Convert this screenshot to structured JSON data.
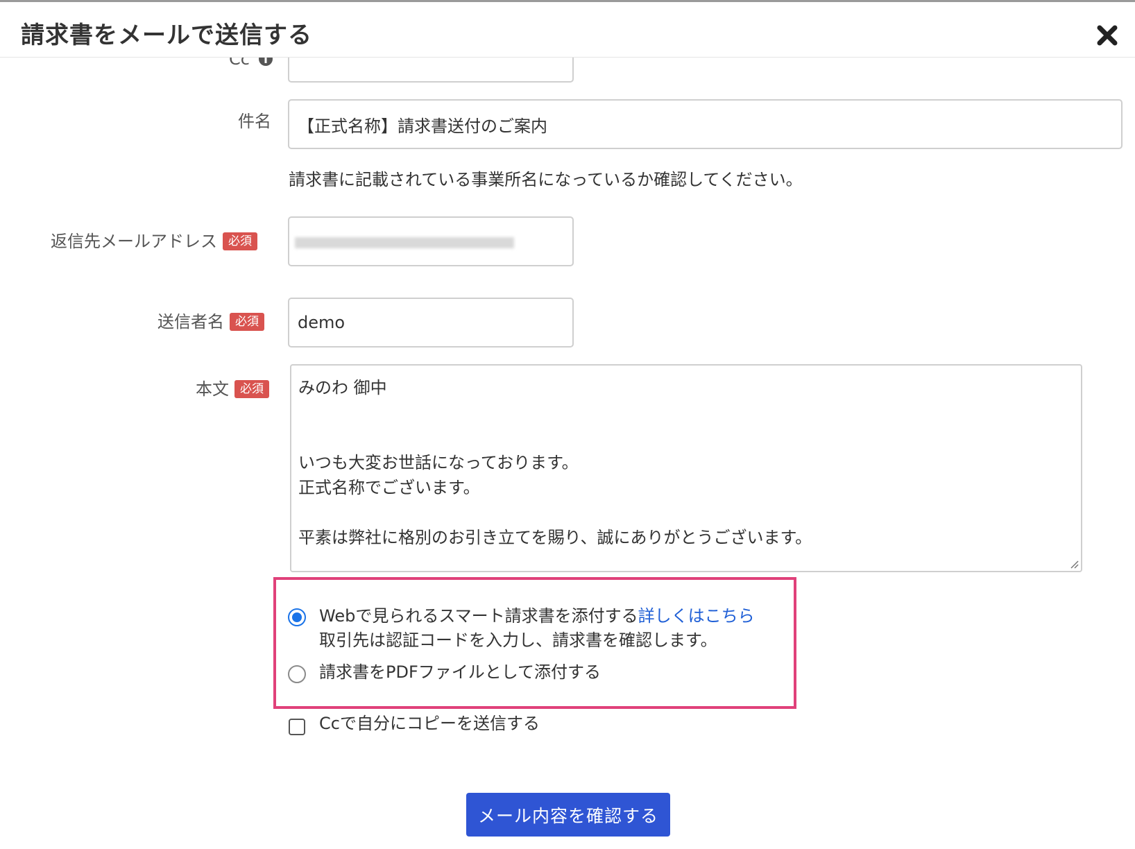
{
  "modal": {
    "title": "請求書をメールで送信する",
    "close_icon": "close-icon"
  },
  "form": {
    "cc": {
      "label": "Cc",
      "info_icon": "info-icon",
      "value": ""
    },
    "subject": {
      "label": "件名",
      "value": "【正式名称】請求書送付のご案内",
      "help": "請求書に記載されている事業所名になっているか確認してください。"
    },
    "reply_to": {
      "label": "返信先メールアドレス",
      "required": "必須"
    },
    "sender_name": {
      "label": "送信者名",
      "required": "必須",
      "value": "demo"
    },
    "body": {
      "label": "本文",
      "required": "必須",
      "value": "みのわ 御中\n\n\nいつも大変お世話になっております。\n正式名称でございます。\n\n平素は弊社に格別のお引き立てを賜り、誠にありがとうございます。"
    },
    "attachment_options": {
      "smart_invoice": {
        "label": "Webで見られるスマート請求書を添付する",
        "link": "詳しくはこちら",
        "note": "取引先は認証コードを入力し、請求書を確認します。",
        "selected": true
      },
      "pdf": {
        "label": "請求書をPDFファイルとして添付する",
        "selected": false
      }
    },
    "cc_self": {
      "label": "Ccで自分にコピーを送信する",
      "checked": false
    },
    "confirm_button": "メール内容を確認する"
  },
  "colors": {
    "required_badge": "#d9534f",
    "primary_button": "#2f55d4",
    "highlight_border": "#e0417a",
    "link": "#1f5fd6",
    "radio_selected": "#1a73e8"
  }
}
